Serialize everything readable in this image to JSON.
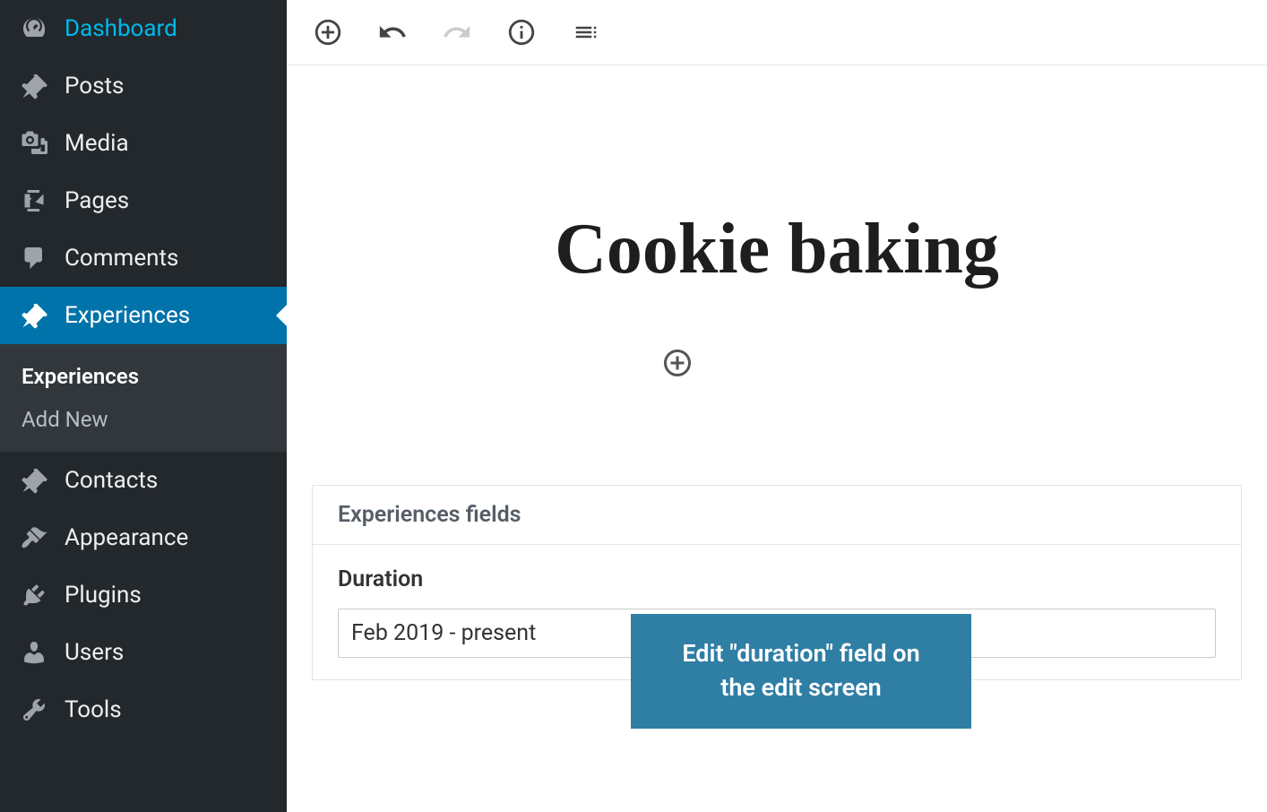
{
  "sidebar": {
    "items": [
      {
        "label": "Dashboard",
        "icon": "dashboard-icon"
      },
      {
        "label": "Posts",
        "icon": "pin-icon"
      },
      {
        "label": "Media",
        "icon": "media-icon"
      },
      {
        "label": "Pages",
        "icon": "pages-icon"
      },
      {
        "label": "Comments",
        "icon": "comment-icon"
      },
      {
        "label": "Experiences",
        "icon": "pin-icon"
      },
      {
        "label": "Contacts",
        "icon": "pin-icon"
      },
      {
        "label": "Appearance",
        "icon": "appearance-icon"
      },
      {
        "label": "Plugins",
        "icon": "plugins-icon"
      },
      {
        "label": "Users",
        "icon": "users-icon"
      },
      {
        "label": "Tools",
        "icon": "tools-icon"
      }
    ],
    "submenu": {
      "items": [
        {
          "label": "Experiences"
        },
        {
          "label": "Add New"
        }
      ]
    }
  },
  "editor": {
    "title": "Cookie baking"
  },
  "metabox": {
    "header": "Experiences fields",
    "fields": {
      "duration": {
        "label": "Duration",
        "value": "Feb 2019 - present"
      }
    }
  },
  "callout": {
    "text": "Edit \"duration\" field on the edit screen"
  }
}
